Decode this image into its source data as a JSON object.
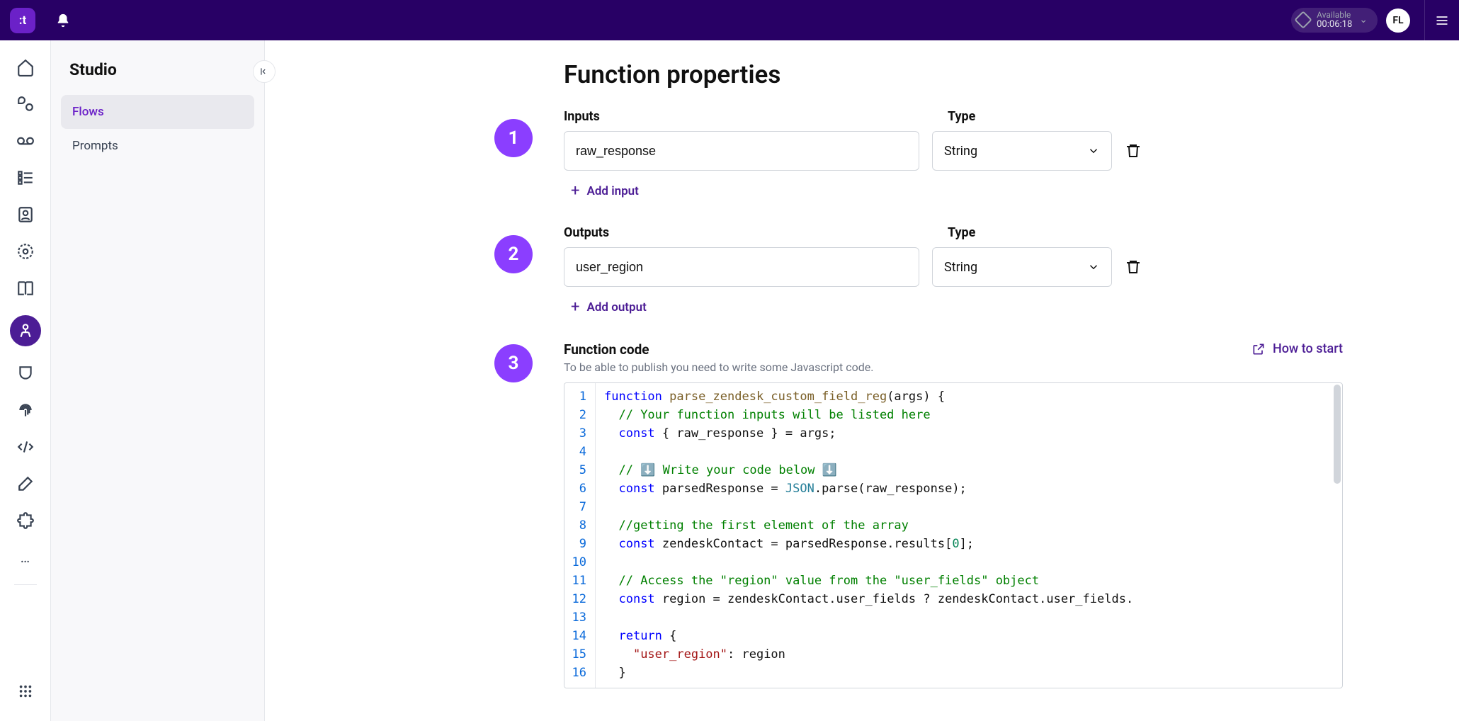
{
  "topbar": {
    "logo_text": ":t",
    "status_label": "Available",
    "status_time": "00:06:18",
    "avatar": "FL"
  },
  "sidebar": {
    "title": "Studio",
    "items": [
      {
        "label": "Flows",
        "active": true
      },
      {
        "label": "Prompts",
        "active": false
      }
    ]
  },
  "page": {
    "title": "Function properties",
    "inputs_label": "Inputs",
    "outputs_label": "Outputs",
    "type_label": "Type",
    "add_input": "Add input",
    "add_output": "Add output",
    "code_title": "Function code",
    "code_sub": "To be able to publish you need to write some Javascript code.",
    "howto": "How to start",
    "input_field": "raw_response",
    "input_type": "String",
    "output_field": "user_region",
    "output_type": "String",
    "badges": {
      "one": "1",
      "two": "2",
      "three": "3"
    }
  },
  "code": {
    "lines": [
      "1",
      "2",
      "3",
      "4",
      "5",
      "6",
      "7",
      "8",
      "9",
      "10",
      "11",
      "12",
      "13",
      "14",
      "15",
      "16"
    ],
    "l1_kw": "function",
    "l1_fn": "parse_zendesk_custom_field_reg",
    "l1_rest": "(args) {",
    "l2": "// Your function inputs will be listed here",
    "l3_kw": "const",
    "l3_rest": " { raw_response } = args;",
    "l5": "// ⬇️ Write your code below ⬇️",
    "l6_kw": "const",
    "l6_mid": " parsedResponse = ",
    "l6_cls": "JSON",
    "l6_rest": ".parse(raw_response);",
    "l8": "//getting the first element of the array",
    "l9_kw": "const",
    "l9_mid": " zendeskContact = parsedResponse.results[",
    "l9_num": "0",
    "l9_end": "];",
    "l11": "// Access the \"region\" value from the \"user_fields\" object",
    "l12_kw": "const",
    "l12_rest": " region = zendeskContact.user_fields ? zendeskContact.user_fields.",
    "l14_kw": "return",
    "l14_rest": " {",
    "l15_str": "\"user_region\"",
    "l15_rest": ": region",
    "l16": "}"
  }
}
